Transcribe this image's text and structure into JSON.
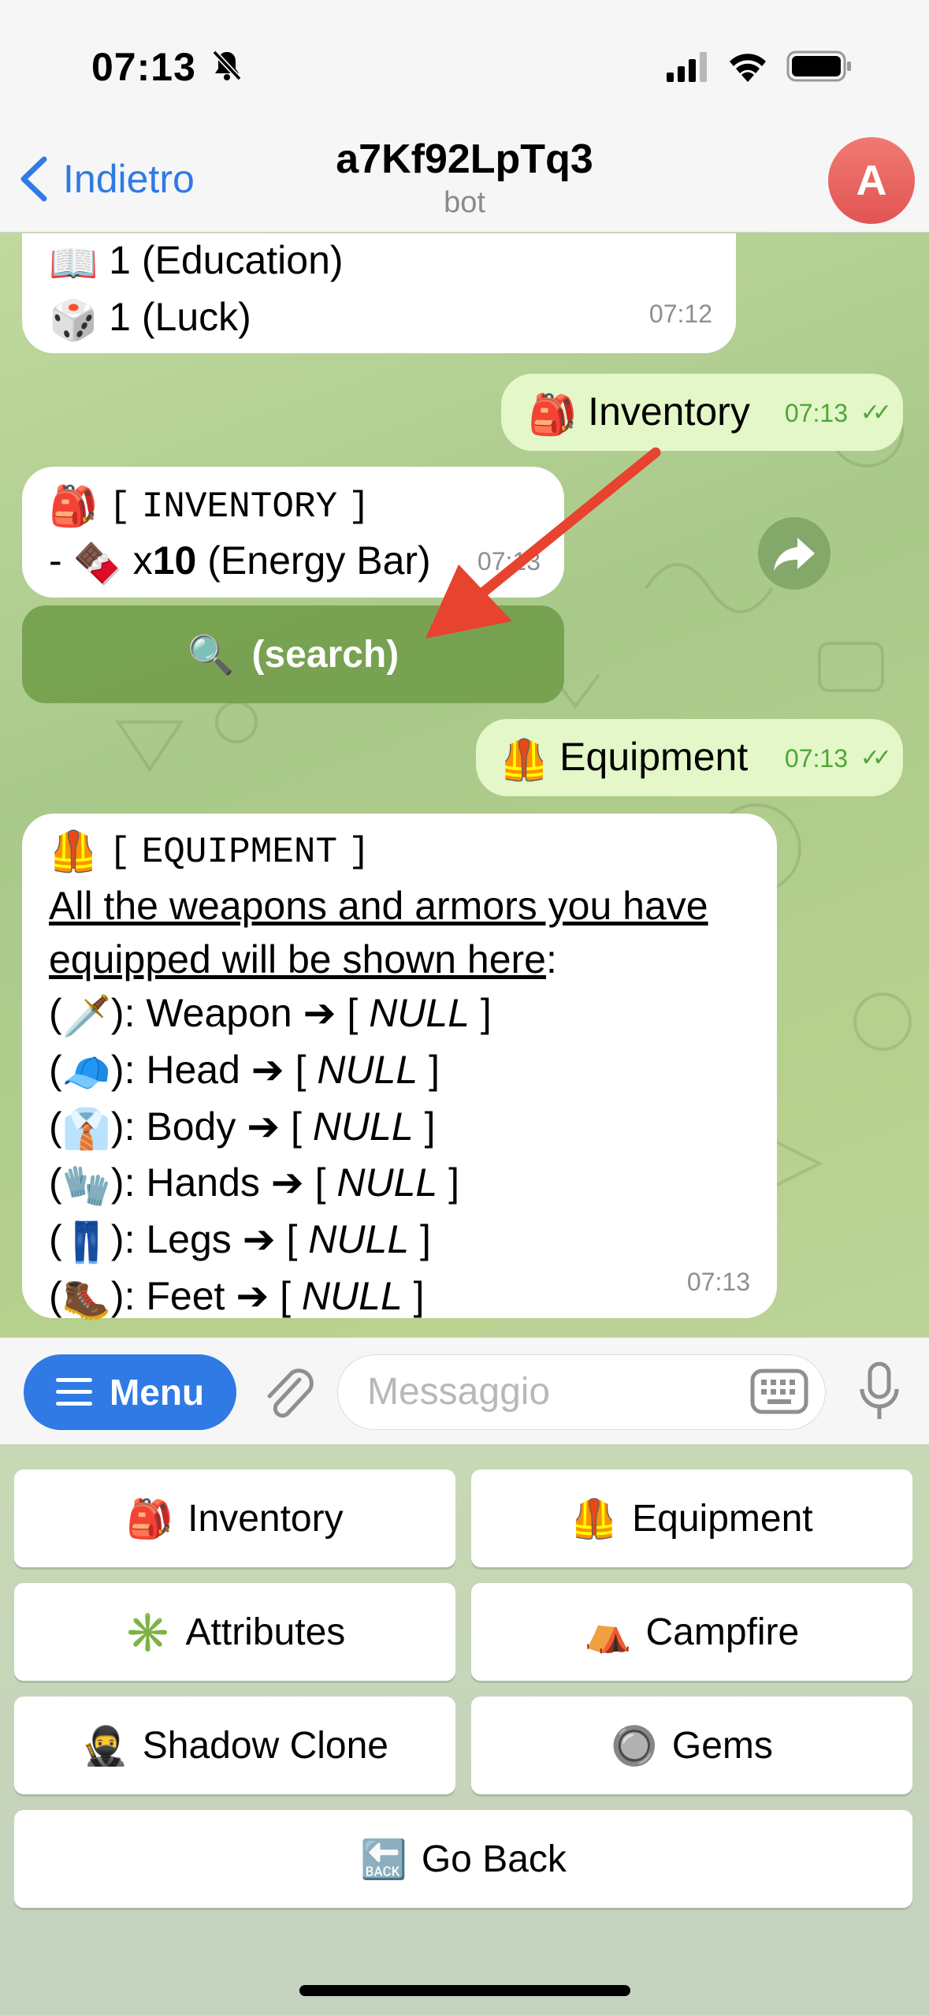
{
  "status_bar": {
    "time": "07:13"
  },
  "header": {
    "back_label": "Indietro",
    "title": "a7Kf92LpTq3",
    "subtitle": "bot",
    "avatar_initial": "A"
  },
  "messages": {
    "attributes_tail": {
      "line1": "1 (Education)",
      "line2": "1 (Luck)",
      "time": "07:12",
      "emoji1": "📖",
      "emoji2": "🎲"
    },
    "inventory_cmd": {
      "emoji": "🎒",
      "text": "Inventory",
      "time": "07:13",
      "ticks": "✓✓"
    },
    "inventory_reply": {
      "emoji": "🎒",
      "title_open": "[",
      "title": "INVENTORY",
      "title_close": "]",
      "item_prefix": "-",
      "item_emoji": "🍫",
      "qty_prefix": "x",
      "qty": "10",
      "item_name": "(Energy Bar)",
      "time": "07:13",
      "button_emoji": "🔍",
      "button_label": "(search)"
    },
    "equipment_cmd": {
      "emoji": "🦺",
      "text": "Equipment",
      "time": "07:13",
      "ticks": "✓✓"
    },
    "equipment_reply": {
      "emoji": "🦺",
      "title_open": "[",
      "title": "EQUIPMENT",
      "title_close": "]",
      "intro1": "All the weapons and armors you have",
      "intro2": "equipped will be shown here",
      "intro_colon": ":",
      "slots": [
        {
          "emoji": "🗡️",
          "label": "Weapon",
          "value": "NULL"
        },
        {
          "emoji": "🧢",
          "label": "Head",
          "value": "NULL"
        },
        {
          "emoji": "👔",
          "label": "Body",
          "value": "NULL"
        },
        {
          "emoji": "🧤",
          "label": "Hands",
          "value": "NULL"
        },
        {
          "emoji": "👖",
          "label": "Legs",
          "value": "NULL"
        },
        {
          "emoji": "🥾",
          "label": "Feet",
          "value": "NULL"
        }
      ],
      "arrow": "➔",
      "time": "07:13"
    }
  },
  "input_bar": {
    "menu_label": "Menu",
    "placeholder": "Messaggio"
  },
  "keyboard": {
    "inventory": {
      "emoji": "🎒",
      "label": "Inventory"
    },
    "equipment": {
      "emoji": "🦺",
      "label": "Equipment"
    },
    "attributes": {
      "emoji": "✳️",
      "label": "Attributes"
    },
    "campfire": {
      "emoji": "⛺",
      "label": "Campfire"
    },
    "shadow_clone": {
      "emoji": "🥷",
      "label": "Shadow Clone"
    },
    "gems": {
      "emoji": "🔘",
      "label": "Gems"
    },
    "go_back": {
      "emoji": "🔙",
      "label": "Go Back"
    }
  },
  "colors": {
    "accent": "#2f7ae5",
    "avatar": "#e25452",
    "outgoing_bubble": "#e3f7c8",
    "annotation_arrow": "#e8432e"
  }
}
